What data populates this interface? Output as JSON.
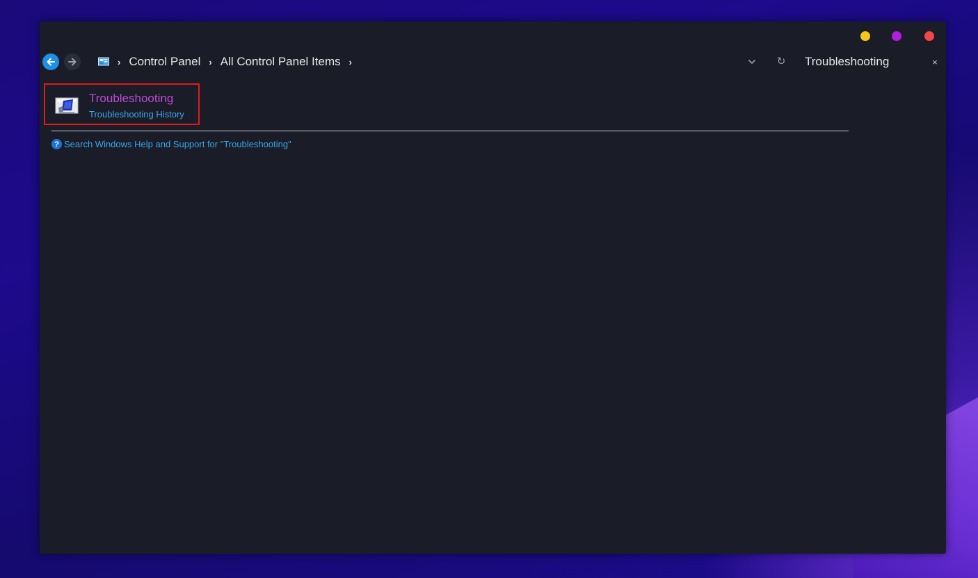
{
  "window": {
    "controls": [
      {
        "name": "minimize-button",
        "color": "#f5c518"
      },
      {
        "name": "maximize-button",
        "color": "#b31de0"
      },
      {
        "name": "close-button",
        "color": "#f04848"
      }
    ]
  },
  "navbar": {
    "back_icon": "arrow-left-icon",
    "forward_icon": "arrow-right-icon",
    "location_icon": "control-panel-icon",
    "breadcrumbs": [
      "Control Panel",
      "All Control Panel Items"
    ],
    "search_value": "Troubleshooting",
    "search_clear_glyph": "×",
    "refresh_glyph": "↻"
  },
  "results": {
    "item_title": "Troubleshooting",
    "item_subtitle": "Troubleshooting History",
    "highlight_color": "#e01b1b"
  },
  "help": {
    "icon_glyph": "?",
    "link_text": "Search Windows Help and Support for \"Troubleshooting\""
  },
  "colors": {
    "window_bg": "#1a1d27",
    "accent_link": "#3aa6e8",
    "visited_title": "#c04ad8"
  }
}
